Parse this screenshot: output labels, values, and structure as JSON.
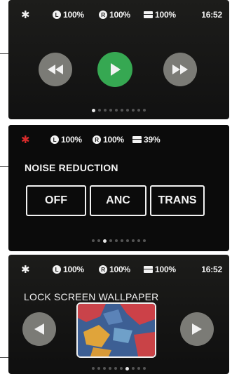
{
  "screen1": {
    "status": {
      "bt_icon": "bluetooth-icon",
      "left_label": "L",
      "left_pct": "100%",
      "right_label": "R",
      "right_pct": "100%",
      "case_pct": "100%",
      "time": "16:52"
    },
    "controls": {
      "prev_icon": "rewind-icon",
      "play_icon": "play-icon",
      "next_icon": "fast-forward-icon"
    },
    "page_dots": {
      "total": 10,
      "active": 1
    }
  },
  "screen2": {
    "status": {
      "bt_icon": "bluetooth-icon",
      "left_label": "L",
      "left_pct": "100%",
      "right_label": "R",
      "right_pct": "100%",
      "case_pct": "39%"
    },
    "title": "NOISE REDUCTION",
    "modes": [
      "OFF",
      "ANC",
      "TRANS"
    ],
    "page_dots": {
      "total": 10,
      "active": 3
    }
  },
  "screen3": {
    "status": {
      "bt_icon": "bluetooth-icon",
      "left_label": "L",
      "left_pct": "100%",
      "right_label": "R",
      "right_pct": "100%",
      "case_pct": "100%",
      "time": "16:52"
    },
    "title": "LOCK SCREEN WALLPAPER",
    "controls": {
      "prev_icon": "chevron-left-icon",
      "next_icon": "chevron-right-icon"
    },
    "page_dots": {
      "total": 10,
      "active": 7
    }
  },
  "colors": {
    "accent_green": "#36a852",
    "bt_red": "#d92b2b",
    "button_grey": "#7b7b76"
  }
}
